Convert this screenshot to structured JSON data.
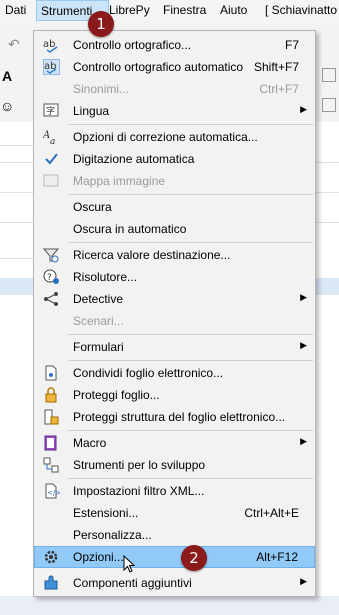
{
  "menubar": {
    "items": [
      "Dati",
      "Strumenti",
      "LibrePy",
      "Finestra",
      "Aiuto",
      "[ Schiavinatto"
    ]
  },
  "menu": {
    "items": [
      {
        "label": "Controllo ortografico...",
        "shortcut": "F7",
        "icon": "spellcheck-icon"
      },
      {
        "label": "Controllo ortografico automatico",
        "shortcut": "Shift+F7",
        "icon": "auto-spellcheck-icon"
      },
      {
        "label": "Sinonimi...",
        "shortcut": "Ctrl+F7",
        "disabled": true
      },
      {
        "label": "Lingua",
        "submenu": true,
        "icon": "language-icon"
      },
      {
        "label": "Opzioni di correzione automatica...",
        "icon": "autocorrect-icon"
      },
      {
        "label": "Digitazione automatica",
        "checked": true,
        "icon": "check-icon"
      },
      {
        "label": "Mappa immagine",
        "disabled": true,
        "icon": "image-map-icon"
      },
      {
        "label": "Oscura"
      },
      {
        "label": "Oscura in automatico"
      },
      {
        "label": "Ricerca valore destinazione...",
        "icon": "goal-seek-icon"
      },
      {
        "label": "Risolutore...",
        "icon": "solver-icon"
      },
      {
        "label": "Detective",
        "submenu": true,
        "icon": "detective-icon"
      },
      {
        "label": "Scenari...",
        "disabled": true
      },
      {
        "label": "Formulari",
        "submenu": true
      },
      {
        "label": "Condividi foglio elettronico...",
        "icon": "share-icon"
      },
      {
        "label": "Proteggi foglio...",
        "icon": "lock-icon"
      },
      {
        "label": "Proteggi struttura del foglio elettronico...",
        "icon": "protect-structure-icon"
      },
      {
        "label": "Macro",
        "submenu": true,
        "icon": "macro-icon"
      },
      {
        "label": "Strumenti per lo sviluppo",
        "icon": "developer-tools-icon"
      },
      {
        "label": "Impostazioni filtro XML...",
        "icon": "xml-filter-icon"
      },
      {
        "label": "Estensioni...",
        "shortcut": "Ctrl+Alt+E"
      },
      {
        "label": "Personalizza..."
      },
      {
        "label": "Opzioni...",
        "shortcut": "Alt+F12",
        "highlighted": true,
        "icon": "gear-icon"
      },
      {
        "label": "Componenti aggiuntivi",
        "submenu": true,
        "icon": "addons-icon"
      }
    ]
  },
  "badges": [
    "1",
    "2"
  ],
  "colors": {
    "highlight": "#91c9f7",
    "badge": "#8b1a1a",
    "menu_bg": "#f2f2f2"
  }
}
